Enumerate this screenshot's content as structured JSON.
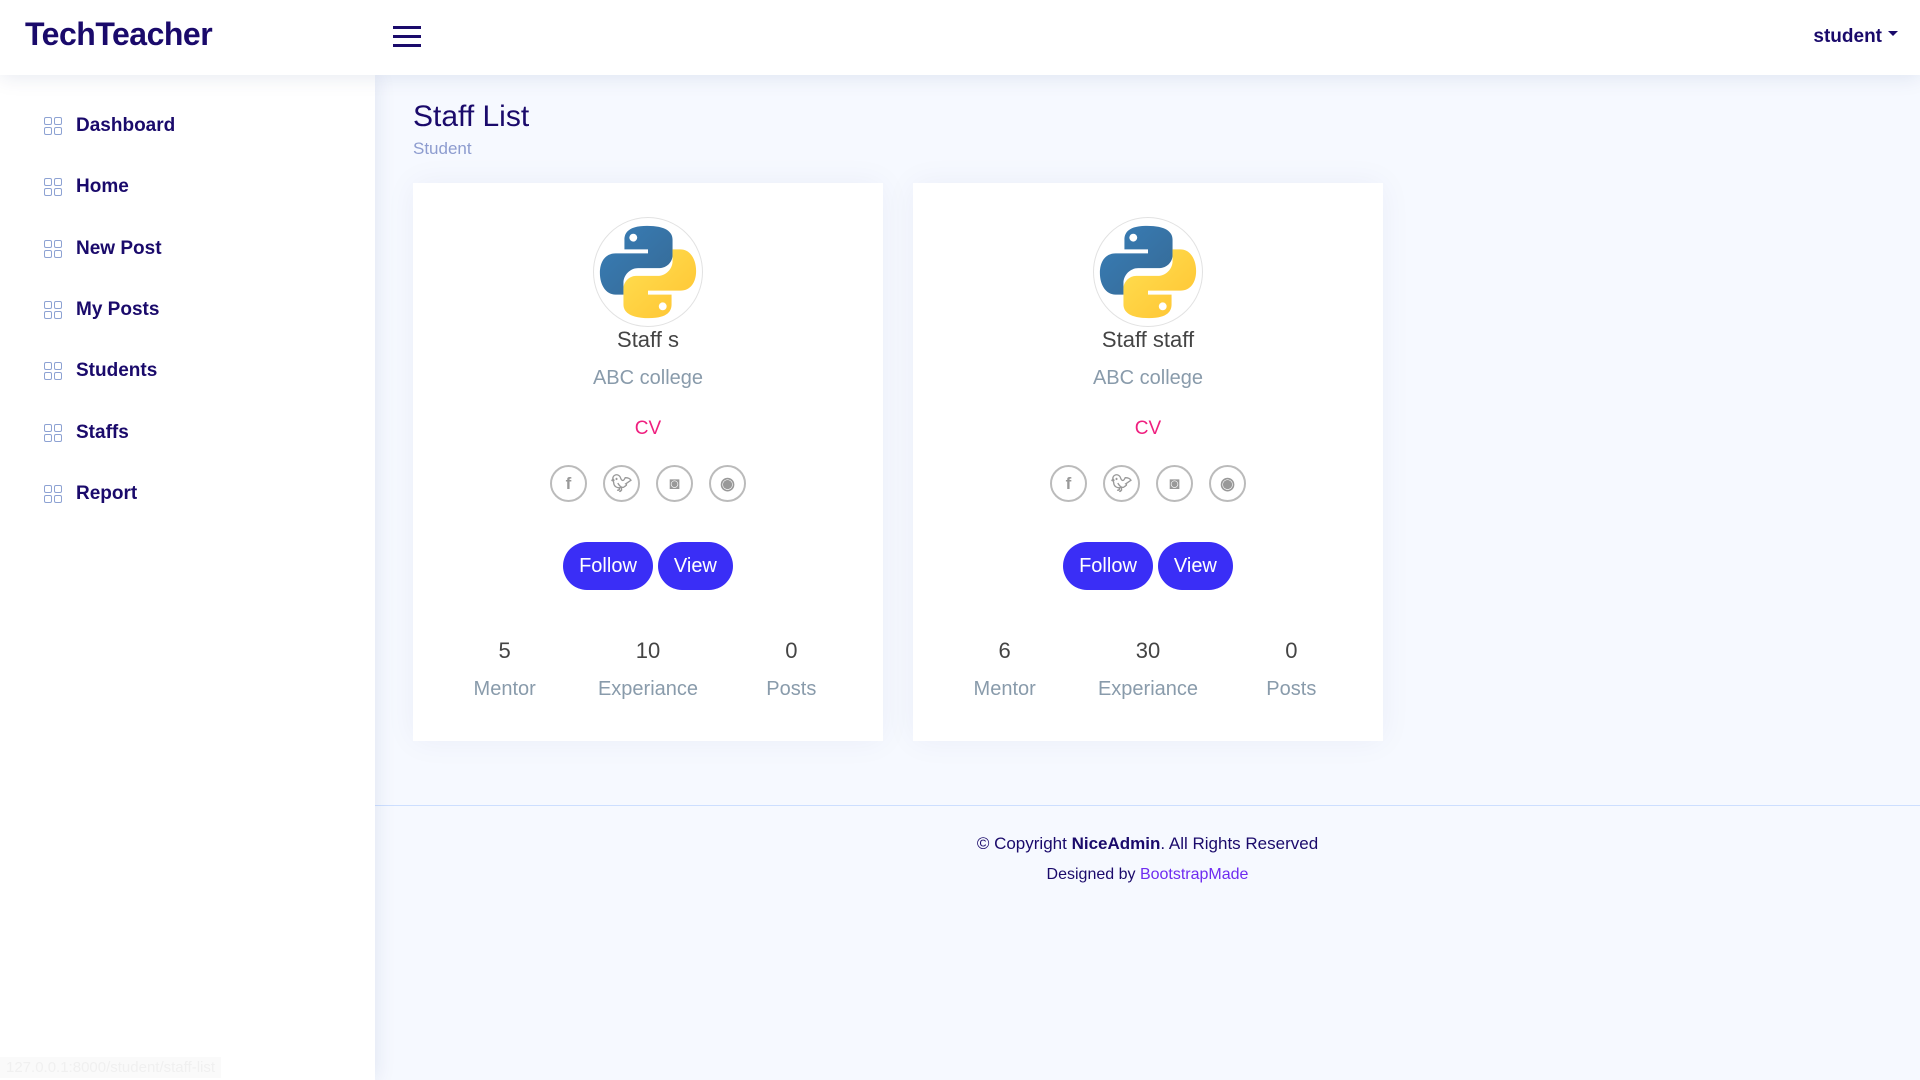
{
  "header": {
    "logo": "TechTeacher",
    "user": "student"
  },
  "sidebar": {
    "items": [
      {
        "label": "Dashboard"
      },
      {
        "label": "Home"
      },
      {
        "label": "New Post"
      },
      {
        "label": "My Posts"
      },
      {
        "label": "Students"
      },
      {
        "label": "Staffs"
      },
      {
        "label": "Report"
      }
    ]
  },
  "page": {
    "title": "Staff List",
    "breadcrumb": "Student"
  },
  "cards": [
    {
      "name": "Staff s",
      "college": "ABC college",
      "cv": "CV",
      "follow": "Follow",
      "view": "View",
      "stats": [
        {
          "value": "5",
          "label": "Mentor"
        },
        {
          "value": "10",
          "label": "Experiance"
        },
        {
          "value": "0",
          "label": "Posts"
        }
      ]
    },
    {
      "name": "Staff staff",
      "college": "ABC college",
      "cv": "CV",
      "follow": "Follow",
      "view": "View",
      "stats": [
        {
          "value": "6",
          "label": "Mentor"
        },
        {
          "value": "30",
          "label": "Experiance"
        },
        {
          "value": "0",
          "label": "Posts"
        }
      ]
    }
  ],
  "footer": {
    "copy_prefix": "© Copyright ",
    "brand": "NiceAdmin",
    "copy_suffix": ". All Rights Reserved",
    "designed_prefix": "Designed by ",
    "designer": "BootstrapMade"
  },
  "status_url": "127.0.0.1:8000/student/staff-list"
}
